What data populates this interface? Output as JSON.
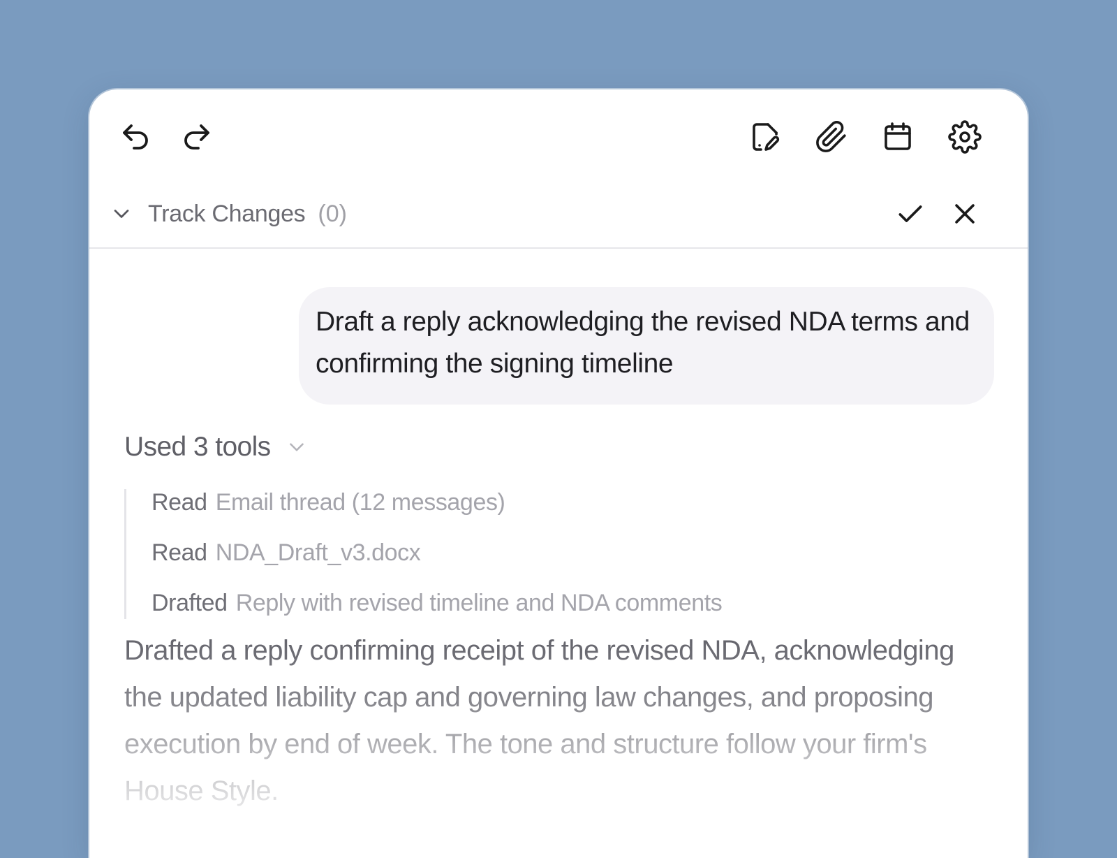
{
  "toolbar": {
    "left_icons": [
      "undo-icon",
      "redo-icon"
    ],
    "right_icons": [
      "edit-document-icon",
      "paperclip-icon",
      "calendar-icon",
      "gear-icon"
    ]
  },
  "track_changes": {
    "label": "Track Changes",
    "count": "(0)",
    "accept_icon": "check-icon",
    "reject_icon": "close-icon"
  },
  "user_message": "Draft a reply acknowledging the revised NDA terms and confirming the signing timeline",
  "tools": {
    "title": "Used 3 tools",
    "items": [
      {
        "verb": "Read",
        "detail": "Email thread (12 messages)"
      },
      {
        "verb": "Read",
        "detail": "NDA_Draft_v3.docx"
      },
      {
        "verb": "Drafted",
        "detail": "Reply with revised timeline and NDA comments"
      }
    ]
  },
  "summary": "Drafted a reply confirming receipt of the revised NDA, acknowledging the updated liability cap and governing law changes, and proposing execution by end of week. The tone and structure follow your firm's House Style.",
  "colors": {
    "background": "#7a9bbf",
    "panel": "#ffffff",
    "bubble": "#f4f3f7",
    "text_primary": "#1e1e22",
    "text_muted": "#6b6b72"
  }
}
